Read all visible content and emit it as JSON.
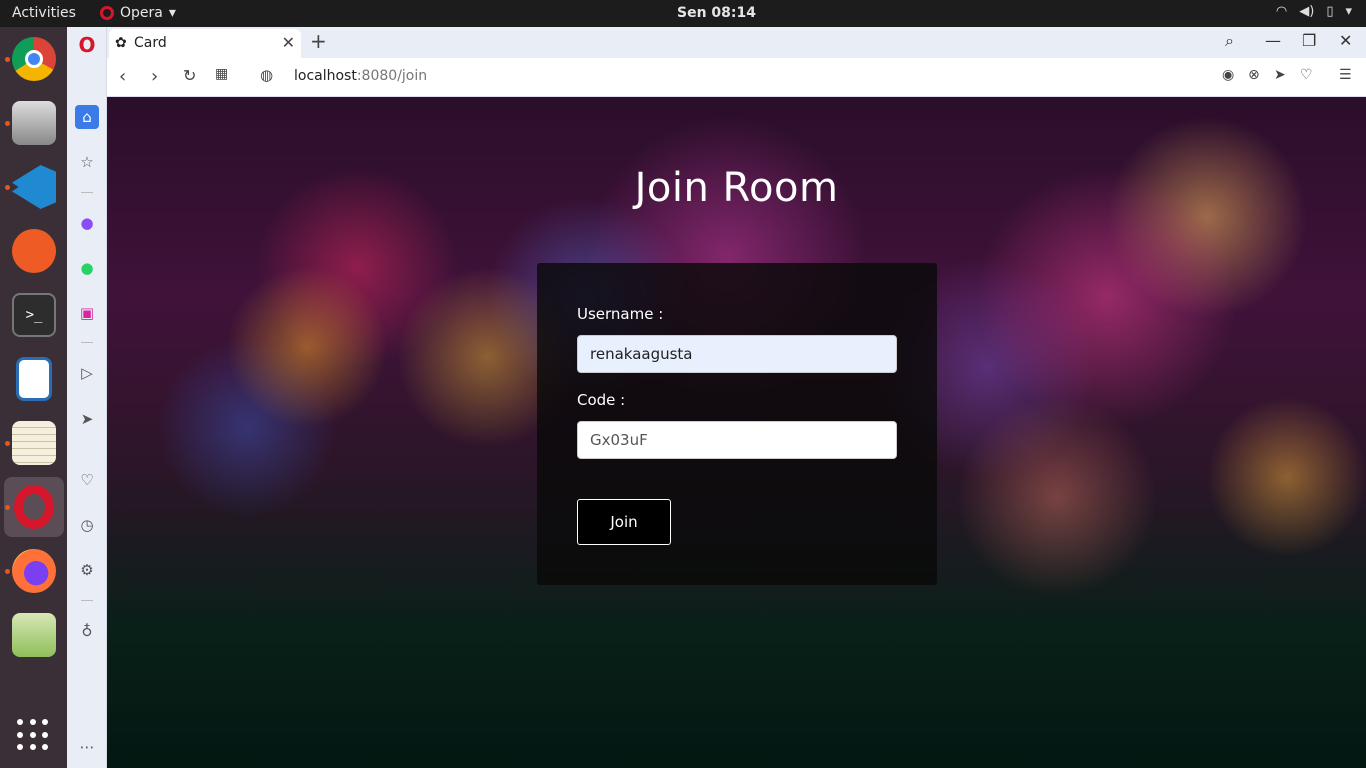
{
  "topbar": {
    "activities": "Activities",
    "app_name": "Opera",
    "clock": "Sen 08:14"
  },
  "browser": {
    "tab": {
      "title": "Card"
    },
    "address": {
      "host": "localhost",
      "rest": ":8080/join"
    }
  },
  "page": {
    "title": "Join Room",
    "form": {
      "username_label": "Username :",
      "username_value": "renakaagusta",
      "code_label": "Code :",
      "code_value": "Gx03uF",
      "join_label": "Join"
    }
  },
  "dock": {
    "items": [
      {
        "name": "chrome-dev-icon",
        "color": "#db4437"
      },
      {
        "name": "files-icon",
        "color": "#8a8a8a"
      },
      {
        "name": "vscode-icon",
        "color": "#1f8ad2"
      },
      {
        "name": "postman-icon",
        "color": "#ef5b25"
      },
      {
        "name": "terminal-icon",
        "color": "#2d2d2d"
      },
      {
        "name": "libreoffice-writer-icon",
        "color": "#2a6db5"
      },
      {
        "name": "text-editor-icon",
        "color": "#e8e2c8"
      },
      {
        "name": "opera-icon",
        "color": "#d6162b"
      },
      {
        "name": "firefox-icon",
        "color": "#ff7139"
      },
      {
        "name": "image-viewer-icon",
        "color": "#8fbf5a"
      }
    ]
  },
  "colors": {
    "opera_red": "#d6162b",
    "accent_blue": "#3a7be8"
  }
}
